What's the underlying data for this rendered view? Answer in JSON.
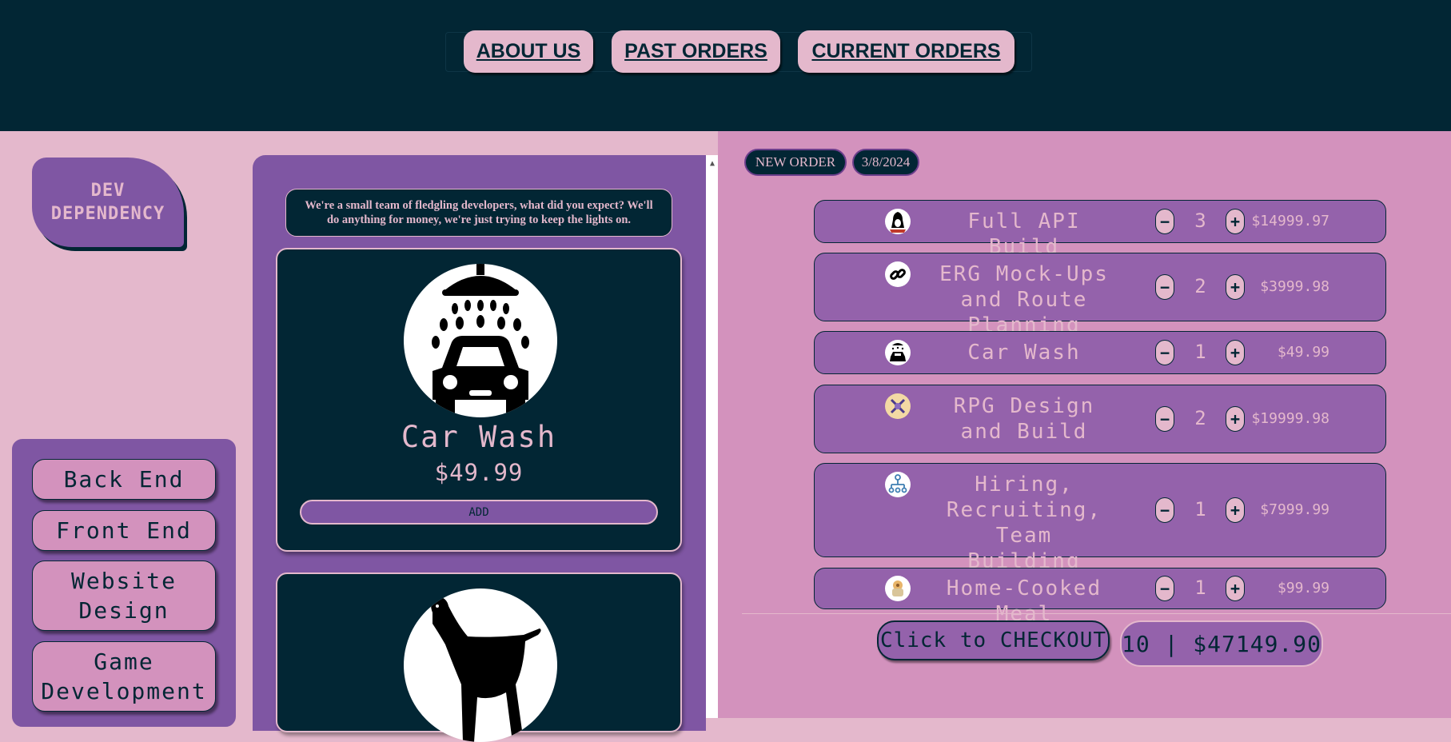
{
  "nav": {
    "about_label": "ABOUT US",
    "past_orders_label": "PAST ORDERS",
    "current_orders_label": "CURRENT ORDERS"
  },
  "logo": {
    "line1": "DEV",
    "line2": "DEPENDENCY"
  },
  "categories": [
    {
      "label": "Back End"
    },
    {
      "label": "Front End"
    },
    {
      "label": "Website Design"
    },
    {
      "label": "Game Development"
    }
  ],
  "services": {
    "tagline": "We're a small team of fledgling developers, what did you expect? We'll do anything for money, we're just trying to keep the lights on.",
    "cards": [
      {
        "name": "Car Wash",
        "price": "$49.99",
        "add_label": "ADD",
        "icon": "car-wash-icon"
      },
      {
        "name": "",
        "price": "",
        "add_label": "",
        "icon": "dog-icon"
      }
    ]
  },
  "order": {
    "status_label": "NEW ORDER",
    "date": "3/8/2024",
    "items": [
      {
        "name": "Full API Build",
        "qty": "3",
        "price": "$14999.97",
        "icon": "penguin-icon"
      },
      {
        "name": "ERG Mock-Ups and Route Planning",
        "qty": "2",
        "price": "$3999.98",
        "icon": "link-icon"
      },
      {
        "name": "Car Wash",
        "qty": "1",
        "price": "$49.99",
        "icon": "car-wash-icon"
      },
      {
        "name": "RPG Design and Build",
        "qty": "2",
        "price": "$19999.98",
        "icon": "crossed-swords-icon"
      },
      {
        "name": "Hiring, Recruiting, Team Building",
        "qty": "1",
        "price": "$7999.99",
        "icon": "team-icon"
      },
      {
        "name": "Home-Cooked Meal",
        "qty": "1",
        "price": "$99.99",
        "icon": "meal-icon"
      }
    ],
    "minus_symbol": "−",
    "plus_symbol": "+",
    "checkout_label": "Click to CHECKOUT",
    "total": "10 |  $47149.90"
  },
  "colors": {
    "dark_teal": "#022634",
    "pink": "#e4b8cc",
    "purple": "#7f56a3",
    "light_purple": "#9462ab",
    "mauve": "#d392bd"
  }
}
